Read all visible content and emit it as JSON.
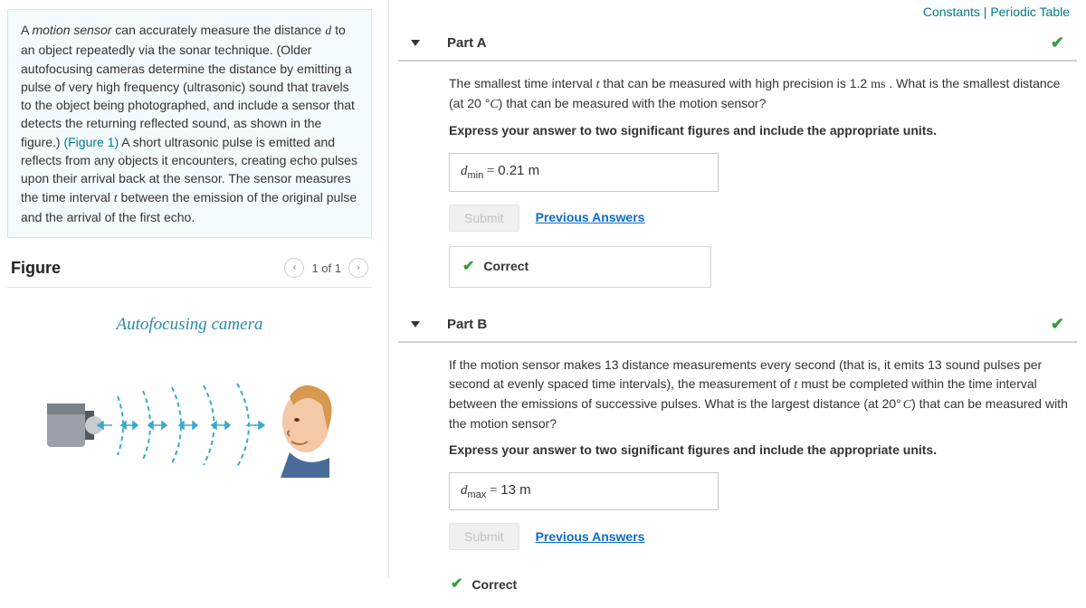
{
  "header": {
    "constants": "Constants",
    "sep": "|",
    "periodic": "Periodic Table"
  },
  "intro": {
    "text_1": "A ",
    "text_em": "motion sensor",
    "text_2": " can accurately measure the distance ",
    "var_d": "d",
    "text_3": " to an object repeatedly via the sonar technique. (Older autofocusing cameras determine the distance by emitting a pulse of very high frequency (ultrasonic) sound that travels to the object being photographed, and include a sensor that detects the returning reflected sound, as shown in the figure.) ",
    "fig_link": "(Figure 1)",
    "text_4": " A short ultrasonic pulse is emitted and reflects from any objects it encounters, creating echo pulses upon their arrival back at the sensor. The sensor measures the time interval ",
    "var_t": "t",
    "text_5": " between the emission of the original pulse and the arrival of the first echo."
  },
  "figure": {
    "title": "Figure",
    "pager": "1 of 1",
    "caption": "Autofocusing camera"
  },
  "partA": {
    "title": "Part A",
    "prompt_1": "The smallest time interval ",
    "var_t": "t",
    "prompt_2": " that can be measured with high precision is 1.2 ",
    "unit_ms": "ms",
    "prompt_3": " . What is the smallest distance (at 20 ",
    "degC": "C",
    "prompt_4": ") that can be measured with the motion sensor?",
    "bold": "Express your answer to two significant figures and include the appropriate units.",
    "ans_var": "d",
    "ans_sub": "min",
    "ans_eq": " = ",
    "ans_val": "0.21 m",
    "submit": "Submit",
    "prev": "Previous Answers",
    "correct": "Correct"
  },
  "partB": {
    "title": "Part B",
    "prompt_1": "If the motion sensor makes 13 distance measurements every second (that is, it emits 13 sound pulses per second at evenly spaced time intervals), the measurement of ",
    "var_t": "t",
    "prompt_2": " must be completed within the time interval between the emissions of successive pulses. What is the largest distance (at 20",
    "degC": "C",
    "prompt_3": ") that can be measured with the motion sensor?",
    "bold": "Express your answer to two significant figures and include the appropriate units.",
    "ans_var": "d",
    "ans_sub": "max",
    "ans_eq": " = ",
    "ans_val": "13 m",
    "submit": "Submit",
    "prev": "Previous Answers",
    "correct": "Correct"
  }
}
